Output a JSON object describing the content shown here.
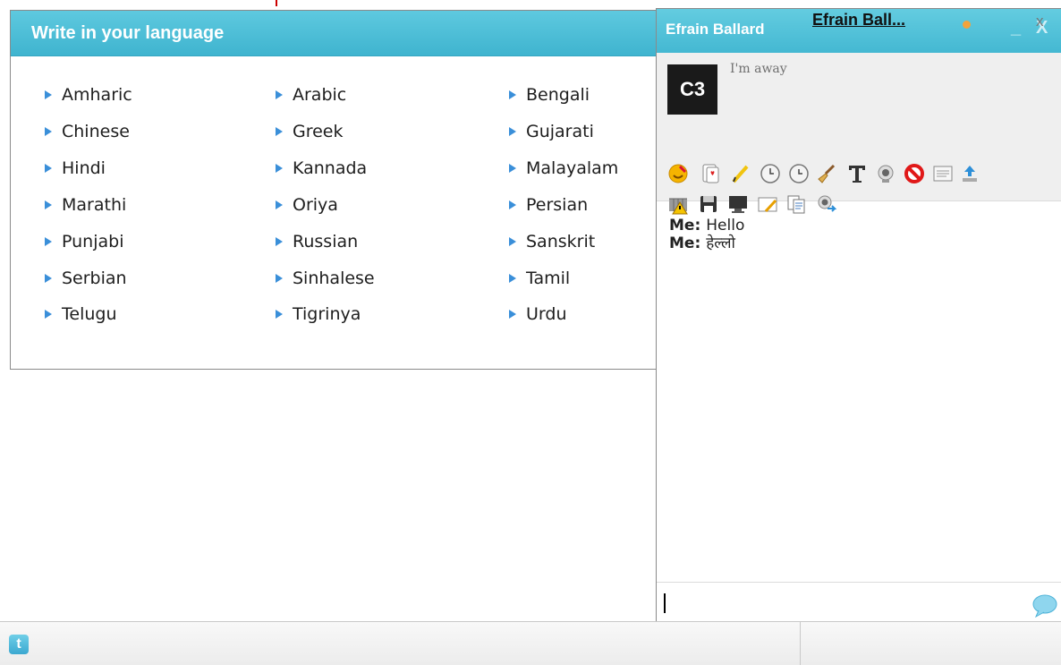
{
  "language_panel": {
    "title": "Write in your language",
    "columns": [
      [
        "Amharic",
        "Chinese",
        "Hindi",
        "Marathi",
        "Punjabi",
        "Serbian",
        "Telugu"
      ],
      [
        "Arabic",
        "Greek",
        "Kannada",
        "Oriya",
        "Russian",
        "Sinhalese",
        "Tigrinya"
      ],
      [
        "Bengali",
        "Gujarati",
        "Malayalam",
        "Persian",
        "Sanskrit",
        "Tamil",
        "Urdu"
      ]
    ]
  },
  "chat": {
    "title": "Efrain Ballard",
    "minimize_label": "_",
    "close_label": "X",
    "avatar_text": "C3",
    "status": "I'm away",
    "messages": [
      {
        "sender": "Me:",
        "text": "Hello"
      },
      {
        "sender": "Me:",
        "text": "हेल्लो"
      }
    ],
    "toolbar_row1": [
      "smiley-icon",
      "card-icon",
      "pencil-icon",
      "clock-icon",
      "broom-icon",
      "text-format-icon",
      "webcam-icon",
      "block-icon",
      "log-icon",
      "upload-icon"
    ],
    "toolbar_row2": [
      "warning-icon",
      "save-icon",
      "monitor-icon",
      "note-icon",
      "copy-icon",
      "webcam-share-icon"
    ]
  },
  "taskbar": {
    "twitter_label": "t",
    "chat_tab_label": "Efrain Ball...",
    "close_label": "x"
  },
  "colors": {
    "header_blue": "#4bbcd6",
    "link_triangle": "#3a8fd9",
    "status_dot": "#f2a33a"
  }
}
